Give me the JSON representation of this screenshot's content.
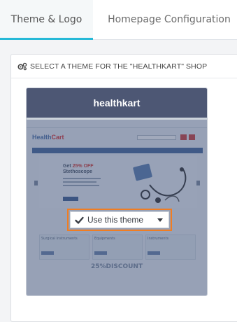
{
  "tabs": [
    {
      "label": "Theme & Logo",
      "active": true
    },
    {
      "label": "Homepage Configuration",
      "active": false
    }
  ],
  "panel": {
    "title": "SELECT A THEME FOR THE \"HEALTHKART\" SHOP",
    "icon": "gears-icon"
  },
  "theme_card": {
    "name": "healthkart",
    "preview": {
      "logo_word1": "Health",
      "logo_word2": "Cart",
      "hero_line1_a": "Get ",
      "hero_line1_b": "25% OFF",
      "hero_line2": "Stethoscope",
      "cat_label_1": "Surgical Instruments",
      "cat_label_2": "Equipments",
      "cat_label_3": "Instruments",
      "discount_text": "25%DISCOUNT"
    },
    "action": {
      "label": "Use this theme",
      "check_icon": "check-icon",
      "caret_icon": "caret-down-icon"
    }
  },
  "colors": {
    "accent": "#25b9d7",
    "highlight": "#f07d22",
    "card_header": "#4d5774"
  }
}
